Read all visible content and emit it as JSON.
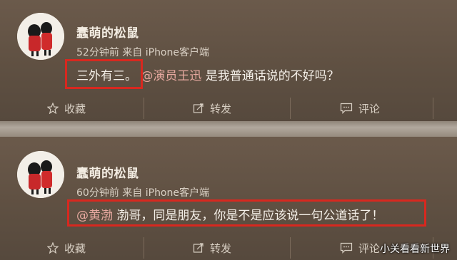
{
  "posts": [
    {
      "username": "蠢萌的松鼠",
      "time": "52分钟前",
      "source": "来自 iPhone客户端",
      "text_highlight": "三外有三。",
      "mention": "@演员王迅",
      "text_after": " 是我普通话说的不好吗？",
      "actions": {
        "favorite": "收藏",
        "forward": "转发",
        "comment": "评论"
      }
    },
    {
      "username": "蠢萌的松鼠",
      "time": "60分钟前",
      "source": "来自 iPhone客户端",
      "mention": "@黄渤",
      "text_after": " 渤哥，同是朋友，你是不是应该说一句公道话了！",
      "actions": {
        "favorite": "收藏",
        "forward": "转发",
        "comment": "评论"
      }
    }
  ],
  "watermark": "小关看看新世界",
  "colors": {
    "highlight_box": "#d8281f",
    "mention": "#e7a9a0",
    "background": "#5f5042"
  }
}
